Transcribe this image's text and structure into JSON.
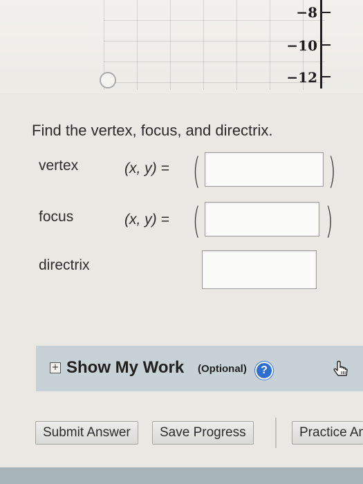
{
  "graph": {
    "y_tick_labels": [
      "−8",
      "−10",
      "−12"
    ]
  },
  "question": {
    "text": "Find the vertex, focus, and directrix."
  },
  "rows": {
    "vertex": {
      "label": "vertex",
      "coord_label": "(x, y) ="
    },
    "focus": {
      "label": "focus",
      "coord_label": "(x, y) ="
    },
    "directrix": {
      "label": "directrix"
    }
  },
  "inputs": {
    "vertex_value": "",
    "focus_value": "",
    "directrix_value": ""
  },
  "work": {
    "expand_glyph": "+",
    "title": "Show My Work",
    "optional": "(Optional)",
    "help_glyph": "?",
    "cursor_icon": "hand-pointer-icon"
  },
  "buttons": {
    "submit": "Submit Answer",
    "save": "Save Progress",
    "practice": "Practice Another Version"
  },
  "colors": {
    "background": "#e9e8e3",
    "work_bar": "#c8d2d6",
    "help_icon": "#2f6fd1"
  }
}
